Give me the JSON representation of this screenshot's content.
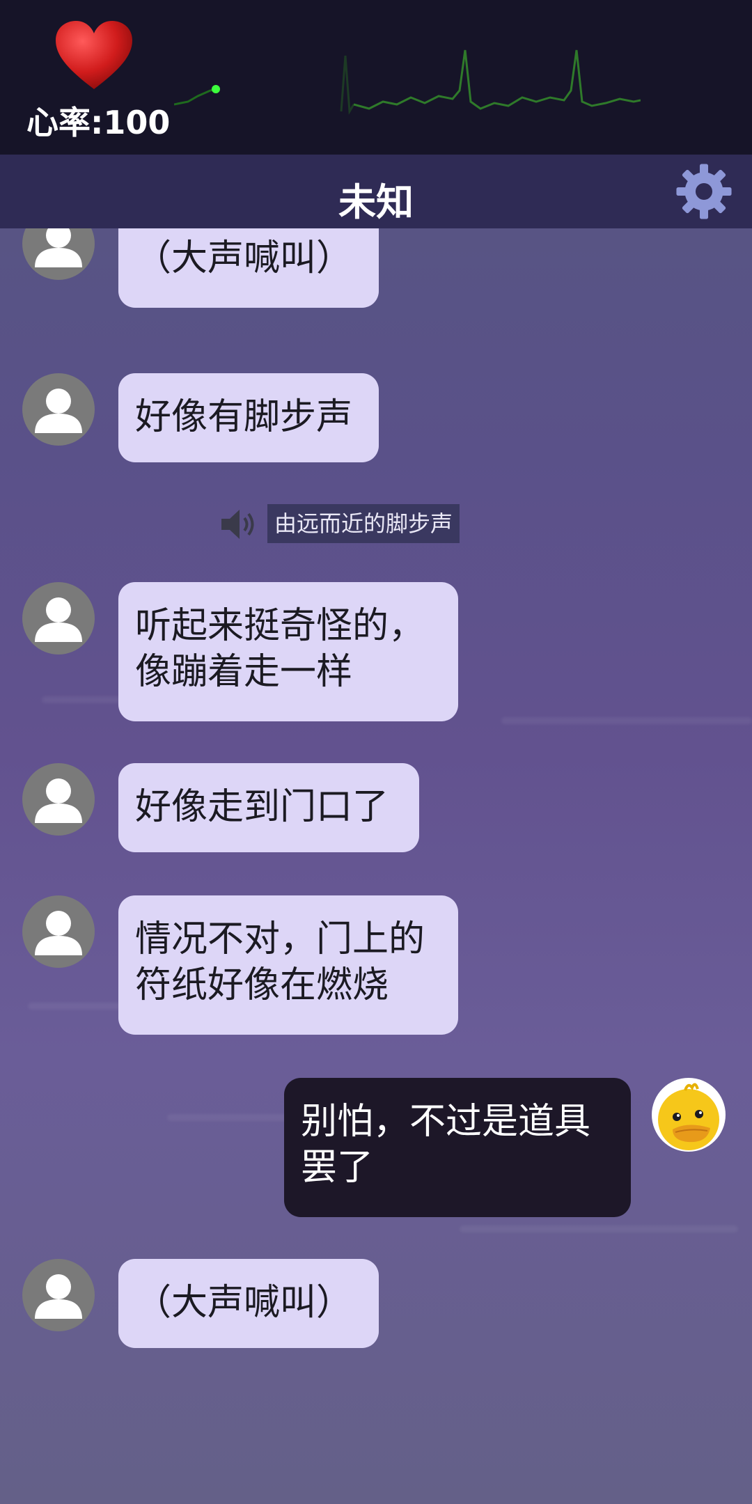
{
  "heart_rate": {
    "label": "心率:100",
    "value": 100
  },
  "header": {
    "title": "未知",
    "settings_icon": "gear-icon"
  },
  "colors": {
    "top_bar": "#161428",
    "title_bar": "#2f2b55",
    "incoming_bubble": "#ddd6f7",
    "outgoing_bubble": "#1d1728",
    "ecg_line": "#2f7a2a",
    "ecg_dot": "#3dff3d"
  },
  "messages": [
    {
      "side": "left",
      "avatar": "person-icon",
      "lines": [
        "（大声喊叫）"
      ]
    },
    {
      "side": "left",
      "avatar": "person-icon",
      "lines": [
        "好像有脚步声"
      ]
    },
    {
      "side": "center",
      "icon": "speaker-icon",
      "text": "由远而近的脚步声"
    },
    {
      "side": "left",
      "avatar": "person-icon",
      "lines": [
        "听起来挺奇怪的，",
        "像蹦着走一样"
      ]
    },
    {
      "side": "left",
      "avatar": "person-icon",
      "lines": [
        "好像走到门口了"
      ]
    },
    {
      "side": "left",
      "avatar": "person-icon",
      "lines": [
        "情况不对，门上的",
        "符纸好像在燃烧"
      ]
    },
    {
      "side": "right",
      "avatar": "duck-icon",
      "lines": [
        "别怕，不过是道具",
        "罢了"
      ]
    },
    {
      "side": "left",
      "avatar": "person-icon",
      "lines": [
        "（大声喊叫）"
      ]
    }
  ]
}
